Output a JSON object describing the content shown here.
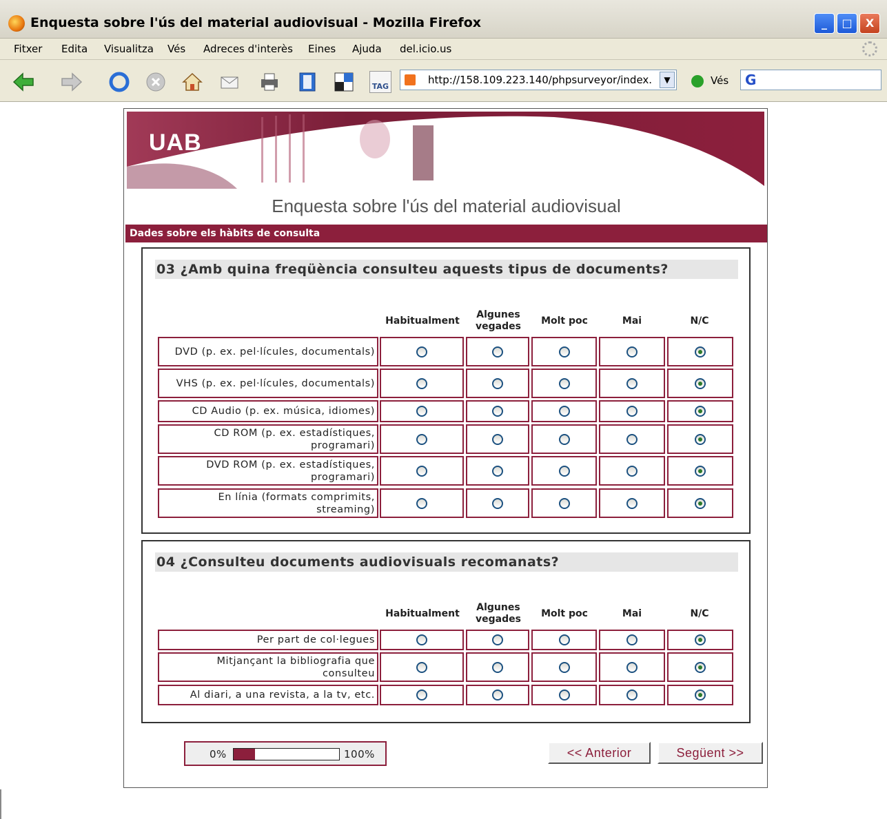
{
  "window": {
    "title": "Enquesta sobre l'ús del material audiovisual - Mozilla Firefox",
    "buttons": {
      "minimize": "_",
      "maximize": "□",
      "close": "X"
    }
  },
  "menu": [
    "Fitxer",
    "Edita",
    "Visualitza",
    "Vés",
    "Adreces d'interès",
    "Eines",
    "Ajuda",
    "del.icio.us"
  ],
  "toolbar": {
    "icons": [
      "back-arrow-icon",
      "forward-arrow-icon",
      "reload-icon",
      "stop-icon",
      "home-icon",
      "mail-icon",
      "print-icon",
      "bookmarks-icon",
      "layout-icon",
      "tag-icon"
    ],
    "tag_label": "TAG",
    "url": "http://158.109.223.140/phpsurveyor/index.",
    "go_label": "Vés",
    "search_logo": "G"
  },
  "page": {
    "logo": "UAB",
    "survey_title": "Enquesta sobre l'ús del material audiovisual",
    "section_title": "Dades sobre els hàbits de consulta",
    "columns": [
      "Habitualment",
      "Algunes vegades",
      "Molt poc",
      "Mai",
      "N/C"
    ],
    "questions": [
      {
        "title": "03 ¿Amb quina freqüència consulteu aquests tipus de documents?",
        "rows": [
          {
            "label": "DVD (p. ex. pel·lícules, documentals)",
            "selected": 4
          },
          {
            "label": "VHS (p. ex. pel·lícules, documentals)",
            "selected": 4
          },
          {
            "label": "CD Audio (p. ex. música, idiomes)",
            "selected": 4
          },
          {
            "label": "CD ROM (p. ex. estadístiques, programari)",
            "selected": 4
          },
          {
            "label": "DVD ROM (p. ex. estadístiques, programari)",
            "selected": 4
          },
          {
            "label": "En línia (formats comprimits, streaming)",
            "selected": 4
          }
        ]
      },
      {
        "title": "04 ¿Consulteu documents audiovisuals recomanats?",
        "rows": [
          {
            "label": "Per part de col·legues",
            "selected": 4
          },
          {
            "label": "Mitjançant la bibliografia que consulteu",
            "selected": 4
          },
          {
            "label": "Al diari, a una revista, a la tv, etc.",
            "selected": 4
          }
        ]
      }
    ],
    "progress": {
      "min_label": "0%",
      "max_label": "100%",
      "value": 0.2
    },
    "buttons": {
      "prev": "<< Anterior",
      "next": "Següent >>"
    }
  },
  "colors": {
    "brand": "#8c1f3c",
    "radio_dot": "#2c7a2c"
  }
}
